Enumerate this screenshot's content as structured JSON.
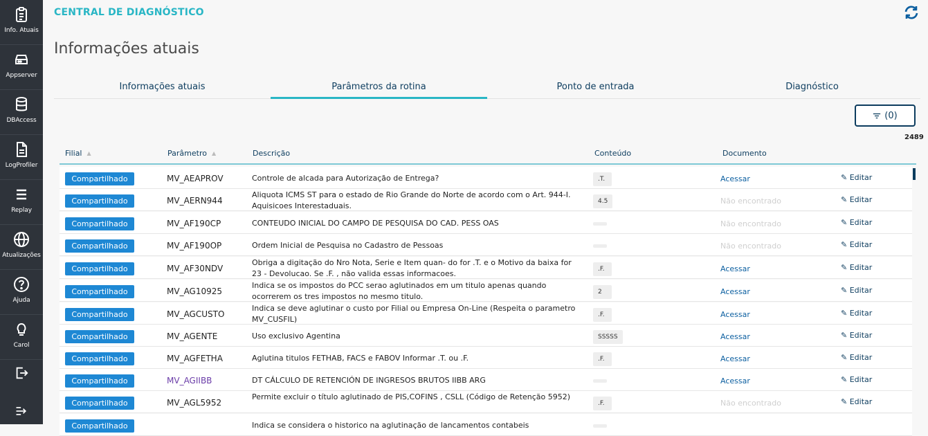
{
  "sidebar": {
    "items": [
      {
        "label": "Info. Atuais",
        "icon": "clipboard-icon"
      },
      {
        "label": "Appserver",
        "icon": "server-icon"
      },
      {
        "label": "DBAccess",
        "icon": "database-icon"
      },
      {
        "label": "LogProfiler",
        "icon": "document-icon"
      },
      {
        "label": "Replay",
        "icon": "replay-icon"
      },
      {
        "label": "Atualizações",
        "icon": "globe-icon"
      },
      {
        "label": "Ajuda",
        "icon": "help-icon"
      },
      {
        "label": "Carol",
        "icon": "lightbulb-icon"
      }
    ],
    "logout_icon": "logout-icon",
    "expand_icon": "expand-icon"
  },
  "header": {
    "app_title": "CENTRAL DE DIAGNÓSTICO",
    "refresh_icon": "refresh-icon"
  },
  "page_title": "Informações atuais",
  "tabs": [
    {
      "label": "Informações atuais",
      "active": false
    },
    {
      "label": "Parâmetros da rotina",
      "active": true
    },
    {
      "label": "Ponto de entrada",
      "active": false
    },
    {
      "label": "Diagnóstico",
      "active": false
    }
  ],
  "filter": {
    "label": "(0)",
    "icon": "filter-icon"
  },
  "record_count": "2489",
  "table": {
    "columns": [
      "Filial",
      "Parâmetro",
      "Descrição",
      "Conteúdo",
      "Documento"
    ],
    "rows": [
      {
        "filial": "Compartilhado",
        "param": "MV_AEAPROV",
        "desc": "Controle de alcada para Autorização de Entrega?",
        "value": ".T.",
        "doc": "Acessar",
        "doc_found": true,
        "edit": "Editar"
      },
      {
        "filial": "Compartilhado",
        "param": "MV_AERN944",
        "desc": "Aliquota ICMS ST para o estado de Rio Grande do Norte de acordo com o Art. 944-I. Aquisicoes Interestaduais.",
        "value": "4.5",
        "doc": "Não encontrado",
        "doc_found": false,
        "edit": "Editar"
      },
      {
        "filial": "Compartilhado",
        "param": "MV_AF190CP",
        "desc": "CONTEUDO INICIAL DO CAMPO DE PESQUISA DO CAD. PESS OAS",
        "value": "",
        "doc": "Não encontrado",
        "doc_found": false,
        "edit": "Editar"
      },
      {
        "filial": "Compartilhado",
        "param": "MV_AF190OP",
        "desc": "Ordem Inicial de Pesquisa no Cadastro de Pessoas",
        "value": "",
        "doc": "Não encontrado",
        "doc_found": false,
        "edit": "Editar"
      },
      {
        "filial": "Compartilhado",
        "param": "MV_AF30NDV",
        "desc": "Obriga a digitação do Nro Nota, Serie e Item quan- do for .T. e o Motivo da baixa for 23 - Devolucao. Se .F. , não valida essas informacoes.",
        "value": ".F.",
        "doc": "Acessar",
        "doc_found": true,
        "edit": "Editar"
      },
      {
        "filial": "Compartilhado",
        "param": "MV_AG10925",
        "desc": "Indica se os impostos do PCC serao aglutinados em um titulo apenas quando ocorrerem os tres impostos no mesmo titulo.",
        "value": "2",
        "doc": "Acessar",
        "doc_found": true,
        "edit": "Editar"
      },
      {
        "filial": "Compartilhado",
        "param": "MV_AGCUSTO",
        "desc": "Indica se deve aglutinar o custo por Filial ou Empresa On-Line (Respeita o parametro MV_CUSFIL)",
        "value": ".F.",
        "doc": "Acessar",
        "doc_found": true,
        "edit": "Editar"
      },
      {
        "filial": "Compartilhado",
        "param": "MV_AGENTE",
        "desc": "Uso exclusivo Agentina",
        "value": "SSSSS",
        "doc": "Acessar",
        "doc_found": true,
        "edit": "Editar"
      },
      {
        "filial": "Compartilhado",
        "param": "MV_AGFETHA",
        "desc": "Aglutina titulos FETHAB, FACS e FABOV Informar .T. ou .F.",
        "value": ".F.",
        "doc": "Acessar",
        "doc_found": true,
        "edit": "Editar"
      },
      {
        "filial": "Compartilhado",
        "param": "MV_AGIIBB",
        "desc": "DT CÁLCULO DE RETENCIÓN DE INGRESOS BRUTOS IIBB ARG",
        "value": "",
        "doc": "Acessar",
        "doc_found": true,
        "edit": "Editar",
        "visited": true
      },
      {
        "filial": "Compartilhado",
        "param": "MV_AGL5952",
        "desc": "Permite excluir o título aglutinado de PIS,COFINS , CSLL (Código de Retenção 5952)",
        "value": ".F.",
        "doc": "Não encontrado",
        "doc_found": false,
        "edit": "Editar"
      },
      {
        "filial": "Compartilhado",
        "param": "",
        "desc": "Indica se considera o historico na aglutinação de lancamentos contabeis",
        "value": "",
        "doc": "",
        "doc_found": true,
        "edit": ""
      }
    ]
  },
  "colors": {
    "sidebar_bg": "#2e333a",
    "accent": "#29b6c5",
    "primary_dark": "#0c3c5e",
    "button_blue": "#1e88d4",
    "link_visited": "#6a3ca8"
  }
}
